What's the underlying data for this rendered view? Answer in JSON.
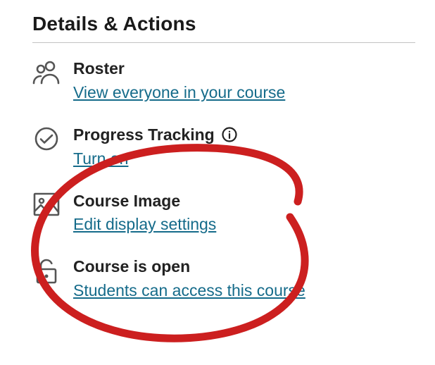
{
  "heading": "Details & Actions",
  "items": {
    "roster": {
      "label": "Roster",
      "link": "View everyone in your course"
    },
    "progress": {
      "label": "Progress Tracking",
      "link": "Turn on"
    },
    "image": {
      "label": "Course Image",
      "link": "Edit display settings"
    },
    "status": {
      "label": "Course is open",
      "link": "Students can access this course"
    }
  },
  "colors": {
    "link": "#156b8a",
    "text": "#222222",
    "annotation": "#cc1f1f"
  }
}
